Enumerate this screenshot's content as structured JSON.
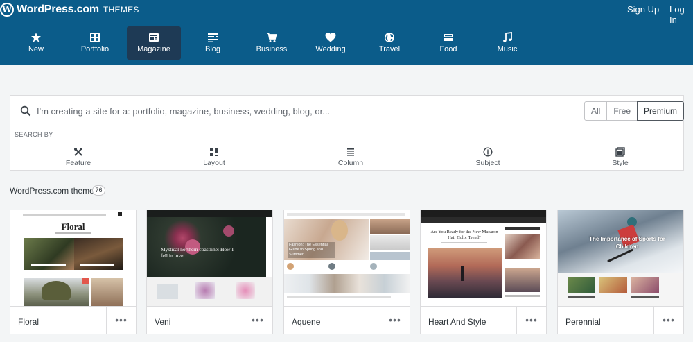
{
  "header": {
    "brand_logo_letter": "W",
    "brand_name": "WordPress.com",
    "brand_sub": "THEMES",
    "signup_label": "Sign Up",
    "login_label": "Log In"
  },
  "categories": [
    {
      "label": "New",
      "icon": "star-icon",
      "active": false
    },
    {
      "label": "Portfolio",
      "icon": "portfolio-icon",
      "active": false
    },
    {
      "label": "Magazine",
      "icon": "magazine-icon",
      "active": true
    },
    {
      "label": "Blog",
      "icon": "blog-icon",
      "active": false
    },
    {
      "label": "Business",
      "icon": "cart-icon",
      "active": false
    },
    {
      "label": "Wedding",
      "icon": "heart-icon",
      "active": false
    },
    {
      "label": "Travel",
      "icon": "globe-icon",
      "active": false
    },
    {
      "label": "Food",
      "icon": "food-icon",
      "active": false
    },
    {
      "label": "Music",
      "icon": "music-note-icon",
      "active": false
    }
  ],
  "search": {
    "placeholder": "I'm creating a site for a: portfolio, magazine, business, wedding, blog, or...",
    "value": "",
    "filters": [
      "All",
      "Free",
      "Premium"
    ],
    "selected_filter": "Premium",
    "search_by_label": "SEARCH BY",
    "facets": [
      {
        "label": "Feature",
        "icon": "tools-icon"
      },
      {
        "label": "Layout",
        "icon": "layout-icon"
      },
      {
        "label": "Column",
        "icon": "column-icon"
      },
      {
        "label": "Subject",
        "icon": "info-icon"
      },
      {
        "label": "Style",
        "icon": "style-icon"
      }
    ]
  },
  "themes": {
    "title": "WordPress.com themes",
    "count": "76",
    "items": [
      {
        "name": "Floral",
        "more": "•••",
        "preview_heading": "Floral"
      },
      {
        "name": "Veni",
        "more": "•••",
        "preview_heading": "Mystical northern coastline: How I fell in love"
      },
      {
        "name": "Aquene",
        "more": "•••",
        "preview_heading": "Fashion: The Essential Guide to Spring and Summer"
      },
      {
        "name": "Heart And Style",
        "more": "•••",
        "preview_heading": "Are You Ready for the New Macaron Hair Color Trend?"
      },
      {
        "name": "Perennial",
        "more": "•••",
        "preview_heading": "The Importance of Sports for Children"
      }
    ]
  },
  "colors": {
    "header_bg": "#0b5c8a",
    "active_tab_bg": "#1e3a55",
    "page_bg": "#f3f5f6"
  }
}
